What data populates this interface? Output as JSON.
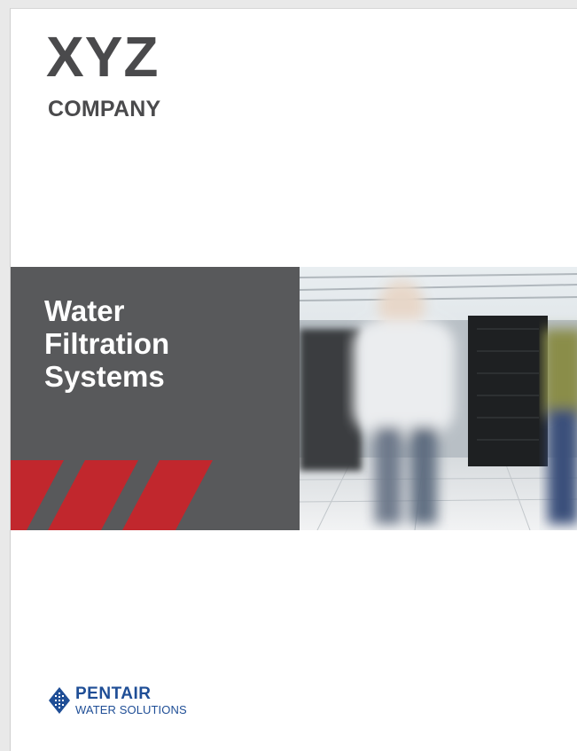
{
  "brand": {
    "name": "XYZ",
    "sub": "COMPANY"
  },
  "cover": {
    "title_lines": [
      "Water",
      "Filtration",
      "Systems"
    ]
  },
  "photo": {
    "icon": "office-blurred-people-photo"
  },
  "logo": {
    "name": "PENTAIR",
    "sub": "WATER SOLUTIONS",
    "icon": "pentair-mark-icon"
  },
  "colors": {
    "dark_grey": "#58595b",
    "accent_red": "#c1272d",
    "logo_blue": "#1f4e96",
    "text_grey": "#4a4a4c"
  }
}
